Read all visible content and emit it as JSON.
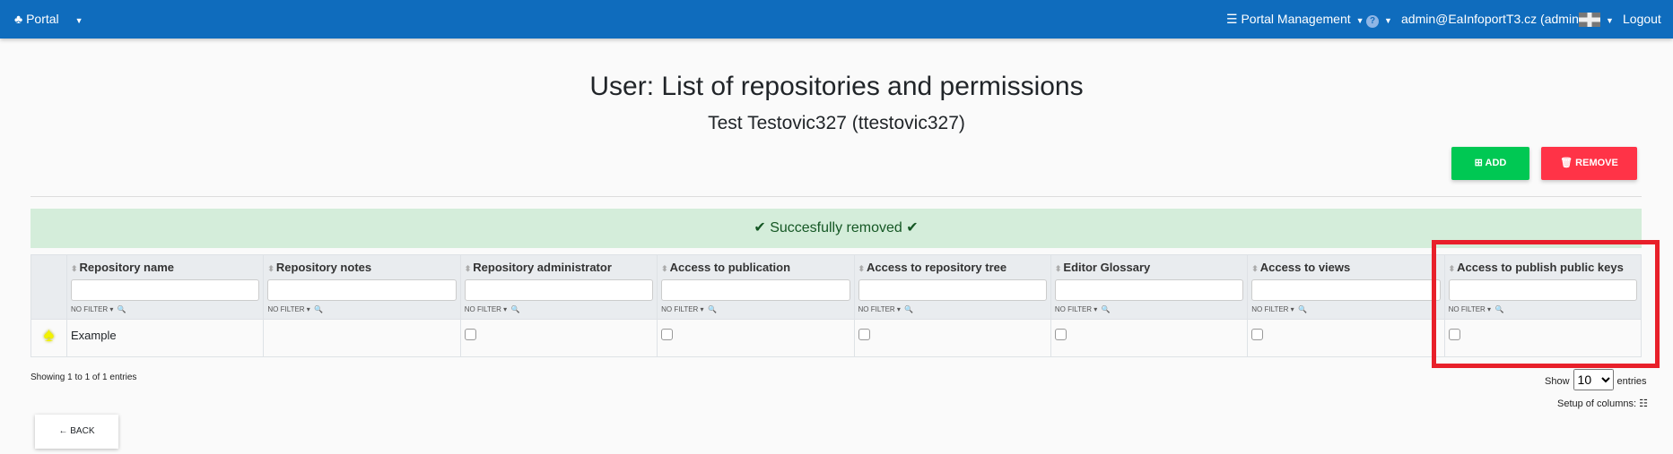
{
  "nav": {
    "brand": "Portal",
    "portal_management": "Portal Management",
    "help": "?",
    "user": "admin@EaInfoportT3.cz (admin)",
    "logout": "Logout",
    "language": "en-GB",
    "color": "#0f6cbd"
  },
  "title": "User: List of repositories and permissions",
  "subtitle": "Test Testovic327 (ttestovic327)",
  "actions": {
    "add": "ADD",
    "remove": "REMOVE"
  },
  "alert": "Succesfully removed",
  "table": {
    "columns": [
      "Repository name",
      "Repository notes",
      "Repository administrator",
      "Access to publication",
      "Access to repository tree",
      "Editor Glossary",
      "Access to views",
      "Access to publish public keys"
    ],
    "filter_label": "NO FILTER",
    "rows": [
      {
        "name": "Example",
        "notes": "",
        "checks": [
          false,
          false,
          false,
          false,
          false,
          false
        ]
      }
    ]
  },
  "footer": {
    "showing": "Showing 1 to 1 of 1 entries",
    "show": "Show",
    "entries": "entries",
    "page_size": "10",
    "setup": "Setup of columns:"
  },
  "back": "BACK"
}
